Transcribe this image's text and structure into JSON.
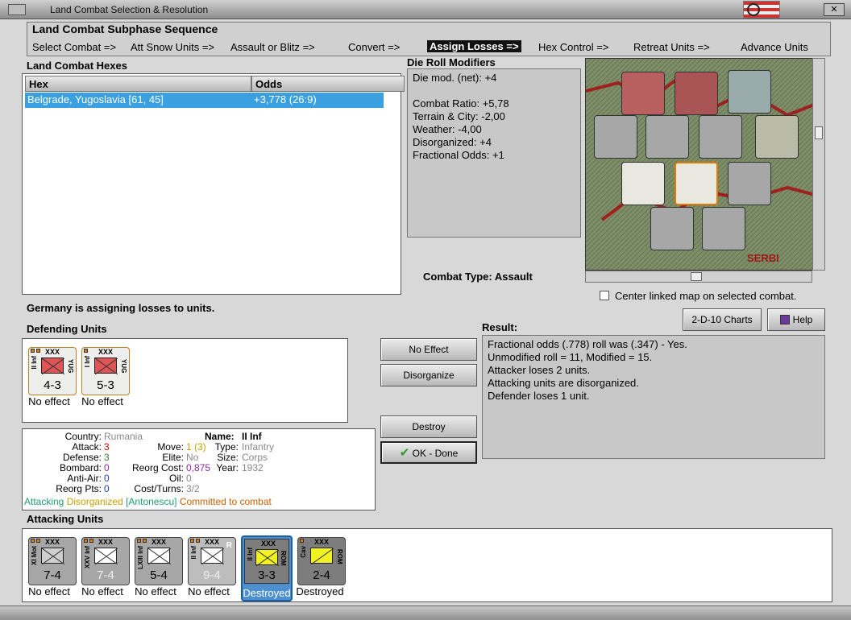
{
  "window": {
    "title": "Land Combat Selection & Resolution",
    "close_glyph": "✕"
  },
  "subphase": {
    "title": "Land Combat Subphase Sequence",
    "steps": [
      "Select Combat =>",
      "Att Snow Units =>",
      "Assault or Blitz =>",
      "Convert =>",
      "Assign Losses =>",
      "Hex Control =>",
      "Retreat Units =>",
      "Advance Units"
    ],
    "active_step": "Assign Losses =>"
  },
  "hexes": {
    "title": "Land Combat Hexes",
    "col_hex": "Hex",
    "col_odds": "Odds",
    "rows": [
      {
        "hex": "Belgrade, Yugoslavia [61, 45]",
        "odds": "+3,778 (26:9)"
      }
    ]
  },
  "modifiers": {
    "title": "Die Roll Modifiers",
    "lines": [
      "Die mod. (net): +4",
      "",
      "Combat Ratio: +5,78",
      "Terrain & City: -2,00",
      "Weather: -4,00",
      "Disorganized: +4",
      "Fractional Odds: +1"
    ]
  },
  "combat_type": {
    "label": "Combat Type:",
    "value": "Assault"
  },
  "center_map": {
    "label": "Center linked map on selected combat.",
    "checked": false
  },
  "status_text": "Germany is assigning losses to units.",
  "buttons": {
    "charts": "2-D-10 Charts",
    "help": "Help",
    "no_effect": "No Effect",
    "disorganize": "Disorganize",
    "destroy": "Destroy",
    "ok_done": "OK - Done"
  },
  "defending": {
    "title": "Defending Units",
    "units": [
      {
        "side": "II Inf",
        "nat": "YUG",
        "size": "XXX",
        "value": "4-3",
        "status": "No effect"
      },
      {
        "side": "I Inf",
        "nat": "YUG",
        "size": "XXX",
        "value": "5-3",
        "status": "No effect"
      }
    ]
  },
  "result": {
    "title": "Result:",
    "lines": [
      "Fractional odds (.778) roll was (.347)  - Yes.",
      "Unmodified roll = 11, Modified = 15.",
      "Attacker loses 2 units.",
      "Attacking units are disorganized.",
      "Defender loses 1 unit."
    ]
  },
  "details": {
    "country_label": "Country:",
    "country": "Rumania",
    "attack_label": "Attack:",
    "attack": "3",
    "defense_label": "Defense:",
    "defense": "3",
    "bombard_label": "Bombard:",
    "bombard": "0",
    "antiair_label": "Anti-Air:",
    "antiair": "0",
    "reorgpts_label": "Reorg Pts:",
    "reorgpts": "0",
    "move_label": "Move:",
    "move": "1 (3)",
    "elite_label": "Elite:",
    "elite": "No",
    "reorgcost_label": "Reorg Cost:",
    "reorgcost": "0,875",
    "oil_label": "Oil:",
    "oil": "0",
    "costturns_label": "Cost/Turns:",
    "costturns": "3/2",
    "name_label": "Name:",
    "name": "II Inf",
    "type_label": "Type:",
    "type": "Infantry",
    "size_label": "Size:",
    "size": "Corps",
    "year_label": "Year:",
    "year": "1932",
    "flags": [
      "Attacking",
      "Disorganized",
      "[Antonescu]",
      "Committed to combat"
    ]
  },
  "attacking": {
    "title": "Attacking Units",
    "units": [
      {
        "side": "XI Mot",
        "nat": "",
        "size": "XXX",
        "value": "7-4",
        "status": "No effect",
        "style": "gray"
      },
      {
        "side": "XXV Inf",
        "nat": "",
        "size": "XXX",
        "value": "7-4",
        "status": "No effect",
        "style": "gray"
      },
      {
        "side": "LXIII Inf",
        "nat": "",
        "size": "XXX",
        "value": "5-4",
        "status": "No effect",
        "style": "gray"
      },
      {
        "side": "II Inf",
        "nat": "R",
        "size": "XXX",
        "value": "9-4",
        "status": "No effect",
        "style": "gray"
      },
      {
        "side": "II Inf",
        "nat": "ROM",
        "size": "XXX",
        "value": "3-3",
        "status": "Destroyed",
        "style": "sel"
      },
      {
        "side": "Cav",
        "nat": "ROM",
        "size": "XXX",
        "value": "2-4",
        "status": "Destroyed",
        "style": "dark"
      }
    ]
  },
  "map": {
    "region_label": "SERBI"
  }
}
